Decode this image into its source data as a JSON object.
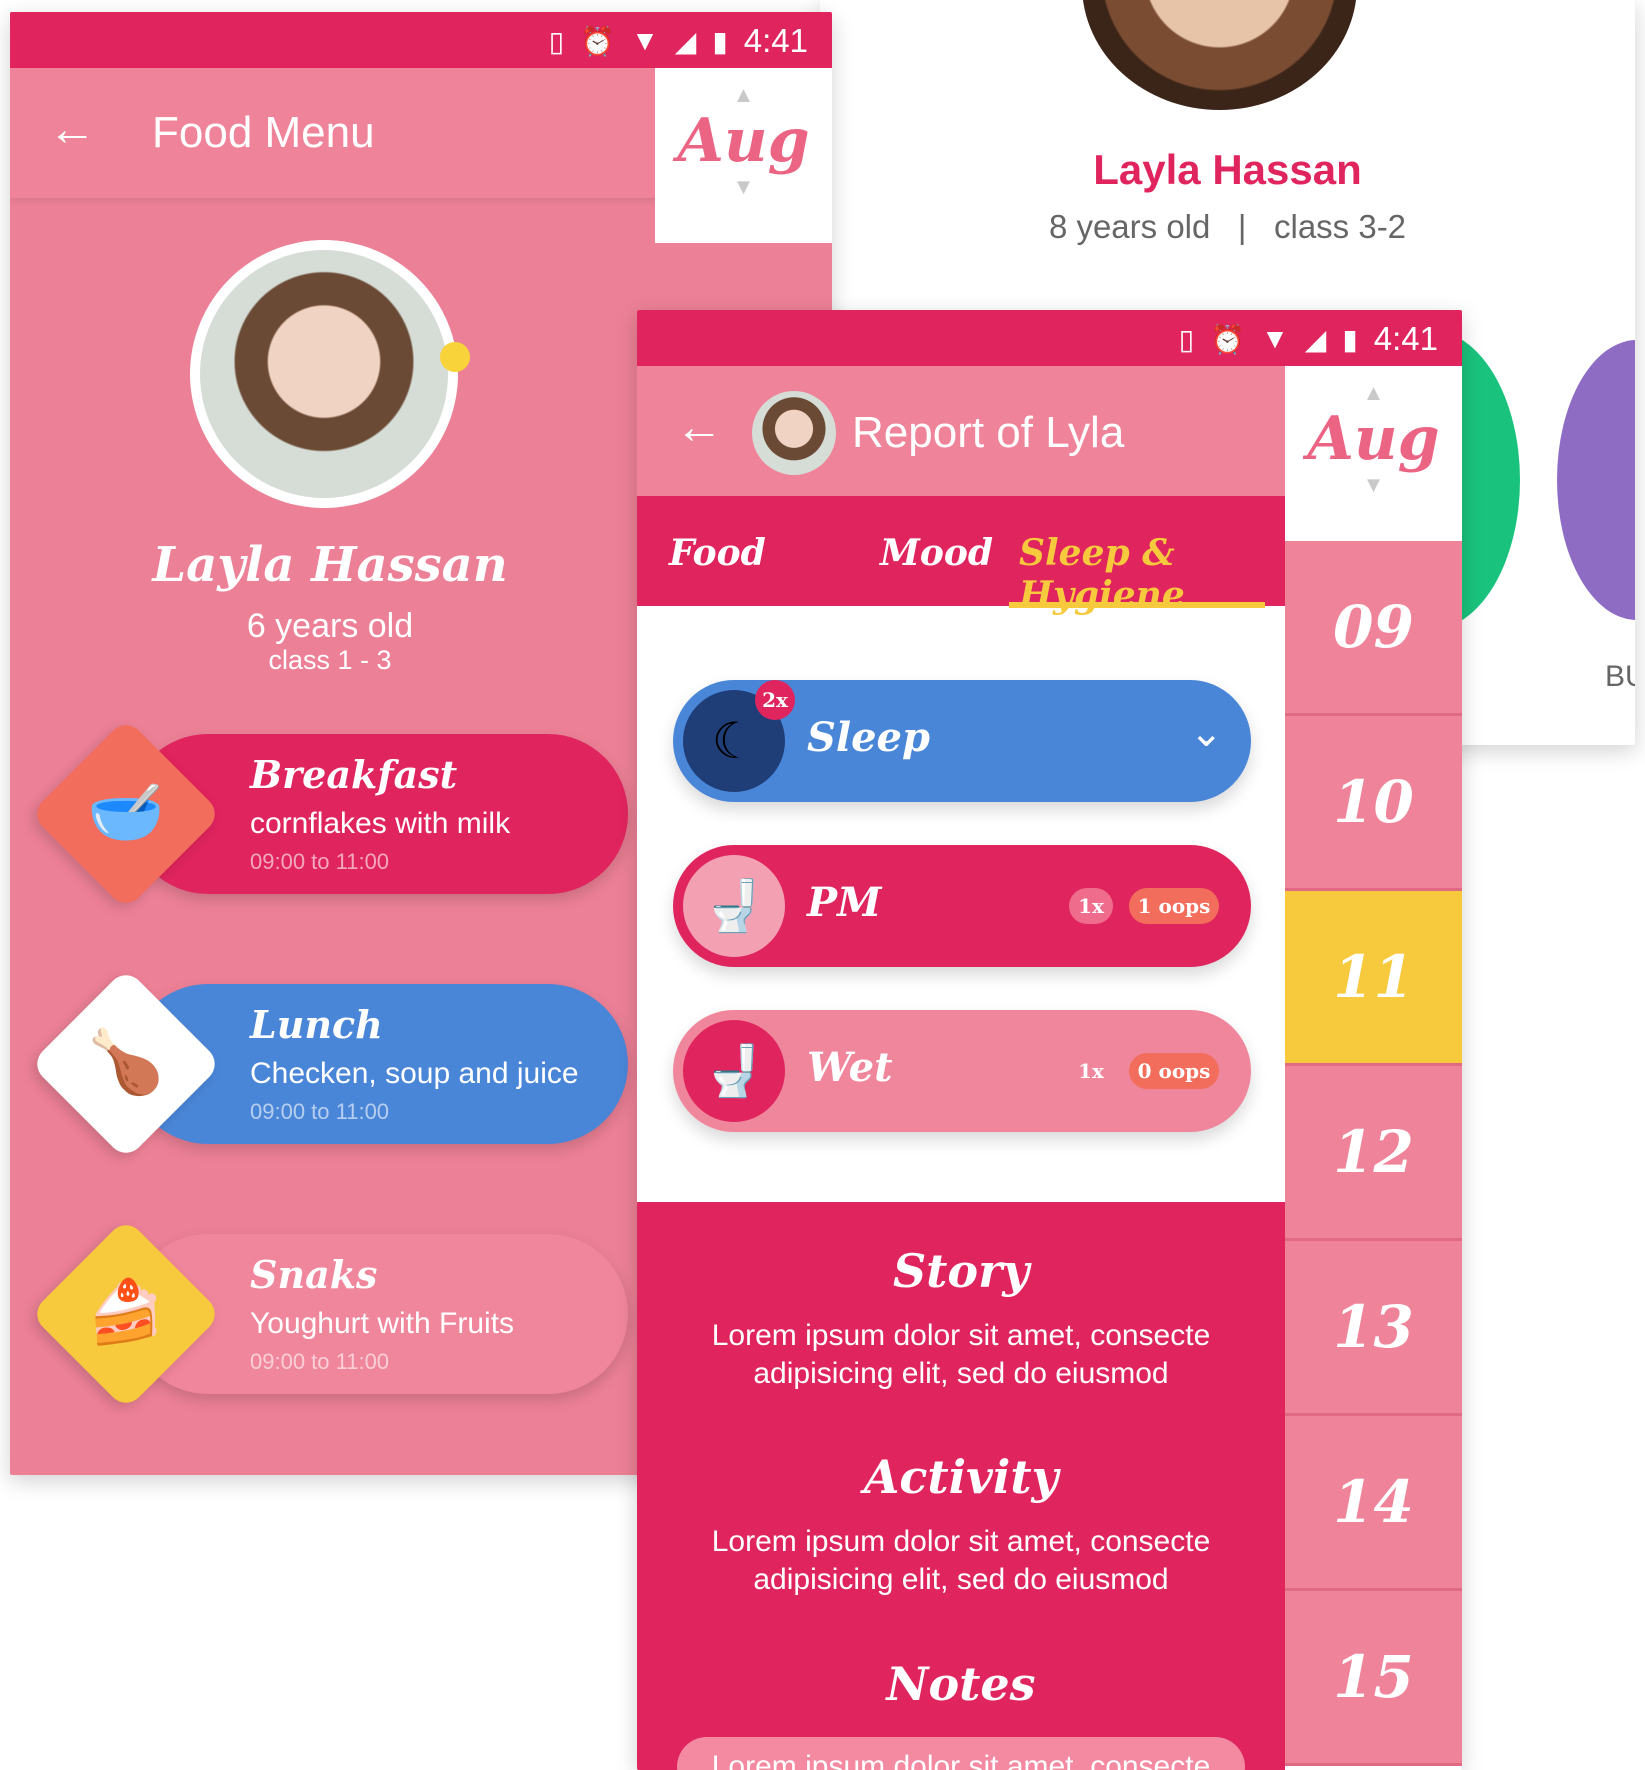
{
  "status": {
    "time": "4:41"
  },
  "profile_card": {
    "name": "Layla Hassan",
    "age": "8 years old",
    "separator": "|",
    "class": "class 3-2",
    "partial_label": "BU"
  },
  "food_menu": {
    "title": "Food Menu",
    "month": "Aug",
    "child": {
      "name": "Layla Hassan",
      "age": "6 years old",
      "class": "class 1 - 3"
    },
    "meals": [
      {
        "title": "Breakfast",
        "desc": "cornflakes with milk",
        "time": "09:00 to 11:00",
        "color": "#e0245e",
        "icon_bg": "#f26d5b",
        "icon": "bowl-icon"
      },
      {
        "title": "Lunch",
        "desc": "Checken, soup and juice",
        "time": "09:00 to 11:00",
        "color": "#4a86d8",
        "icon_bg": "#ffffff",
        "icon": "chicken-icon"
      },
      {
        "title": "Snaks",
        "desc": "Youghurt with Fruits",
        "time": "09:00 to 11:00",
        "color": "#f0869c",
        "icon_bg": "#f7c93d",
        "icon": "cake-icon"
      }
    ]
  },
  "report": {
    "title": "Report of Lyla",
    "month": "Aug",
    "tabs": [
      "Food",
      "Mood",
      "Sleep & Hygiene"
    ],
    "active_tab": "Sleep & Hygiene",
    "items": [
      {
        "label": "Sleep",
        "count_badge": "2x",
        "color": "#4a86d8"
      },
      {
        "label": "PM",
        "count": "1x",
        "oops": "1 oops",
        "color": "#e0245e"
      },
      {
        "label": "Wet",
        "count": "1x",
        "oops": "0 oops",
        "color": "#f0869c"
      }
    ],
    "days": [
      "09",
      "10",
      "11",
      "12",
      "13",
      "14",
      "15"
    ],
    "selected_day": "11",
    "sections": [
      {
        "title": "Story",
        "body": "Lorem ipsum dolor sit amet, consecte adipisicing elit, sed do eiusmod"
      },
      {
        "title": "Activity",
        "body": "Lorem ipsum dolor sit amet, consecte adipisicing elit, sed do eiusmod"
      },
      {
        "title": "Notes",
        "body": "Lorem ipsum dolor sit amet, consecte"
      }
    ]
  },
  "colors": {
    "primary": "#e0245e",
    "pink": "#ef8399",
    "accent": "#f7c93d",
    "blue": "#4a86d8"
  }
}
